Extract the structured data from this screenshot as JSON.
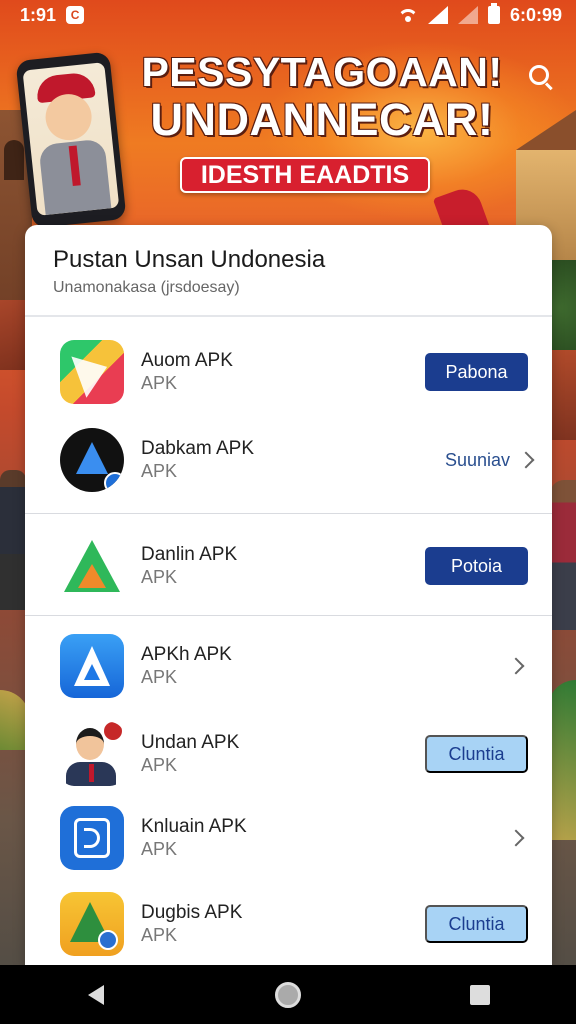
{
  "status_bar": {
    "time_left": "1:91",
    "time_right": "6:0:99"
  },
  "banner": {
    "title_line1": "PESSYTAGOAAN!",
    "title_line2": "UNDANNECAR!",
    "tagline": "IDESTH EAADTIS"
  },
  "card": {
    "title": "Pustan Unsan Undonesia",
    "subtitle": "Unamonakasa (jrsdoesay)"
  },
  "apps": [
    {
      "name": "Auom APK",
      "sub": "APK",
      "action": "Pabona",
      "icon": "play-store-icon"
    },
    {
      "name": "Dabkam APK",
      "sub": "APK",
      "action": "Suuniav",
      "icon": "dark-app-icon"
    },
    {
      "name": "Danlin APK",
      "sub": "APK",
      "action": "Potoia",
      "icon": "triangle-app-icon"
    },
    {
      "name": "APKh APK",
      "sub": "APK",
      "action": "",
      "icon": "app-store-icon"
    },
    {
      "name": "Undan APK",
      "sub": "APK",
      "action": "Cluntia",
      "icon": "person-app-icon"
    },
    {
      "name": "Knluain APK",
      "sub": "APK",
      "action": "",
      "icon": "document-app-icon"
    },
    {
      "name": "Dugbis APK",
      "sub": "APK",
      "action": "Cluntia",
      "icon": "yellow-app-icon"
    }
  ],
  "colors": {
    "primary_button": "#1b3d8f",
    "light_button": "#a8d3f5",
    "banner_red": "#d8202f",
    "header_orange": "#e04a1c"
  }
}
